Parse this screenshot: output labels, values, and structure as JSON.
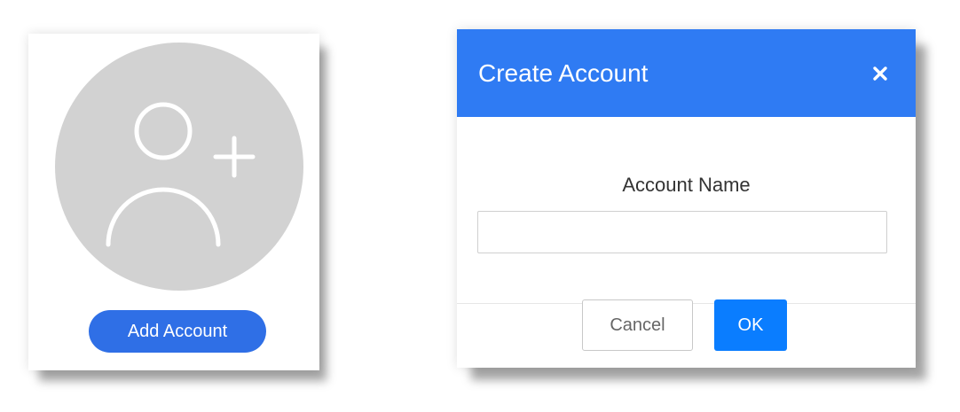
{
  "add_card": {
    "avatar_icon": "user-plus-icon",
    "avatar_color": "#d2d2d2",
    "button_label": "Add Account",
    "button_color": "#2f6fe6"
  },
  "dialog": {
    "title": "Create Account",
    "header_color": "#2f7bf3",
    "close_icon": "close-icon",
    "field_label": "Account Name",
    "input_value": "",
    "input_placeholder": "",
    "cancel_label": "Cancel",
    "ok_label": "OK",
    "ok_color": "#0a7dff"
  }
}
